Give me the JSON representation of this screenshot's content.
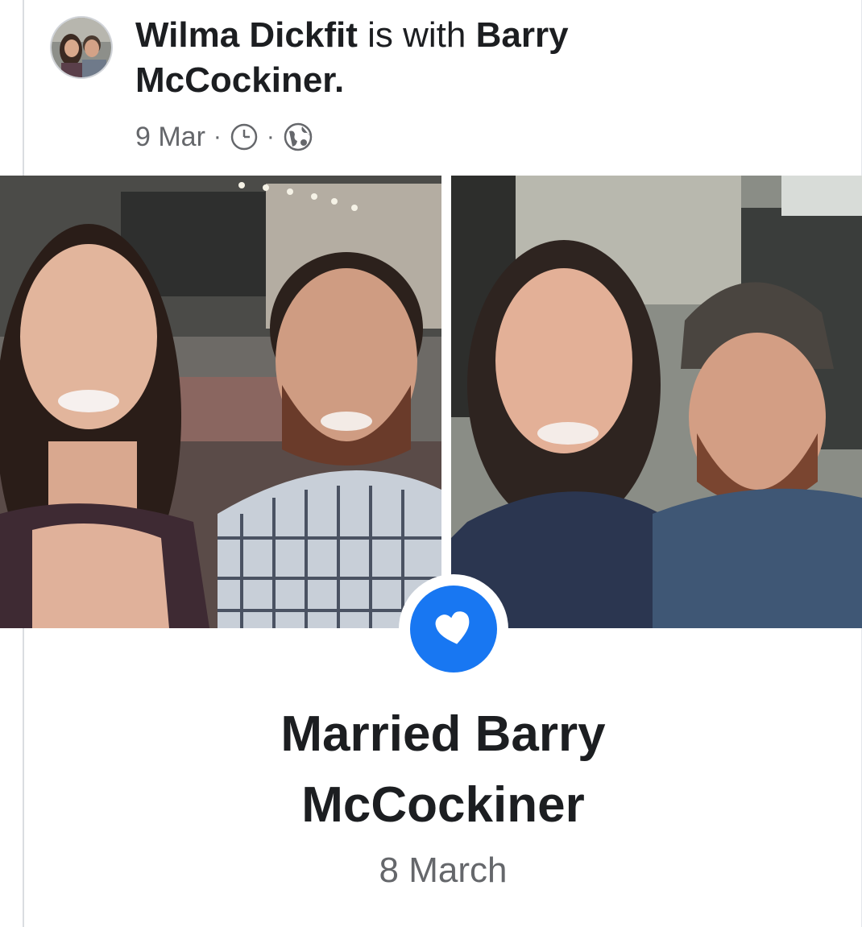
{
  "post": {
    "author": "Wilma Dickfit",
    "with_text": "is with",
    "tagged": "Barry",
    "tagged_last": "McCockiner.",
    "date": "9 Mar",
    "separator": "·",
    "icons": [
      "avatar",
      "clock-icon",
      "globe-icon"
    ]
  },
  "photos": {
    "left": "couple-photo-restaurant",
    "right": "couple-photo-home"
  },
  "life_event": {
    "icon": "heart-icon",
    "title_line1": "Married Barry",
    "title_line2": "McCockiner",
    "date": "8 March"
  },
  "colors": {
    "badge_blue": "#1877f2",
    "meta_gray": "#65676b",
    "text": "#1c1e21"
  }
}
